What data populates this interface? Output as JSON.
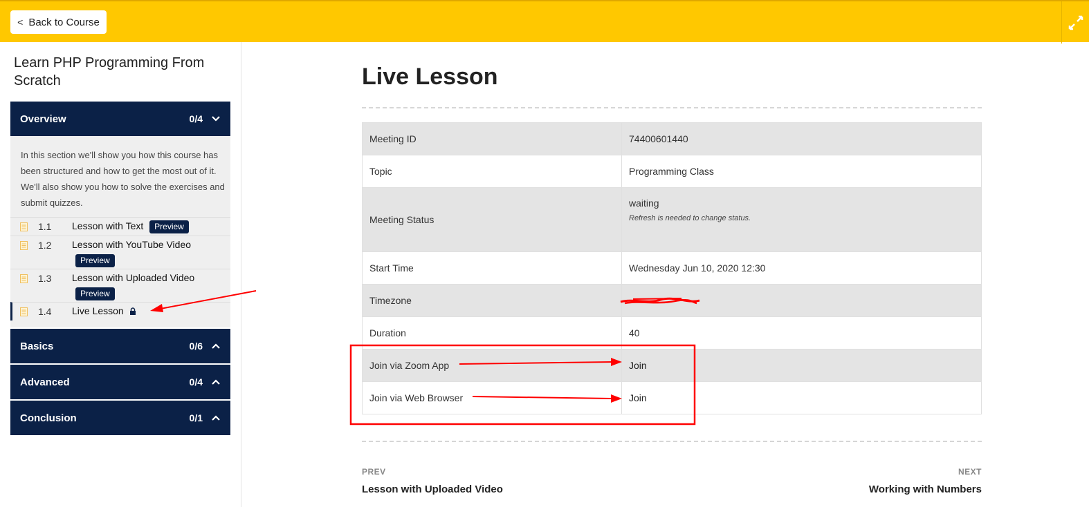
{
  "topbar": {
    "back_label": "Back to Course",
    "back_chevron": "<",
    "expand_icon": "expand-arrows-icon",
    "background_color": "#ffc800"
  },
  "sidebar": {
    "course_title": "Learn PHP Programming From Scratch",
    "sections": [
      {
        "name": "Overview",
        "count": "0/4",
        "expanded": true,
        "description": "In this section we'll show you how this course has been structured and how to get the most out of it. We'll also show you how to solve the exercises and submit quizzes.",
        "lessons": [
          {
            "number": "1.1",
            "title": "Lesson with Text",
            "badge": "Preview",
            "icon": "document-icon"
          },
          {
            "number": "1.2",
            "title": "Lesson with YouTube Video",
            "badge": "Preview",
            "icon": "document-icon"
          },
          {
            "number": "1.3",
            "title": "Lesson with Uploaded Video",
            "badge": "Preview",
            "icon": "document-icon"
          },
          {
            "number": "1.4",
            "title": "Live Lesson",
            "badge": "",
            "icon": "document-icon",
            "locked": true,
            "active": true
          }
        ]
      },
      {
        "name": "Basics",
        "count": "0/6",
        "expanded": false
      },
      {
        "name": "Advanced",
        "count": "0/4",
        "expanded": false
      },
      {
        "name": "Conclusion",
        "count": "0/1",
        "expanded": false
      }
    ],
    "section_color": "#0b2147"
  },
  "main": {
    "title": "Live Lesson",
    "table": [
      {
        "key": "Meeting ID",
        "value": "74400601440"
      },
      {
        "key": "Topic",
        "value": "Programming Class"
      },
      {
        "key": "Meeting Status",
        "value": "waiting",
        "note": "Refresh is needed to change status."
      },
      {
        "key": "Start Time",
        "value": "Wednesday Jun 10, 2020 12:30"
      },
      {
        "key": "Timezone",
        "value": ""
      },
      {
        "key": "Duration",
        "value": "40"
      },
      {
        "key": "Join via Zoom App",
        "value": "Join"
      },
      {
        "key": "Join via Web Browser",
        "value": "Join"
      }
    ],
    "prev": {
      "label": "PREV",
      "title": "Lesson with Uploaded Video"
    },
    "next": {
      "label": "NEXT",
      "title": "Working with Numbers"
    }
  },
  "annotations": {
    "color": "#ff0000"
  }
}
